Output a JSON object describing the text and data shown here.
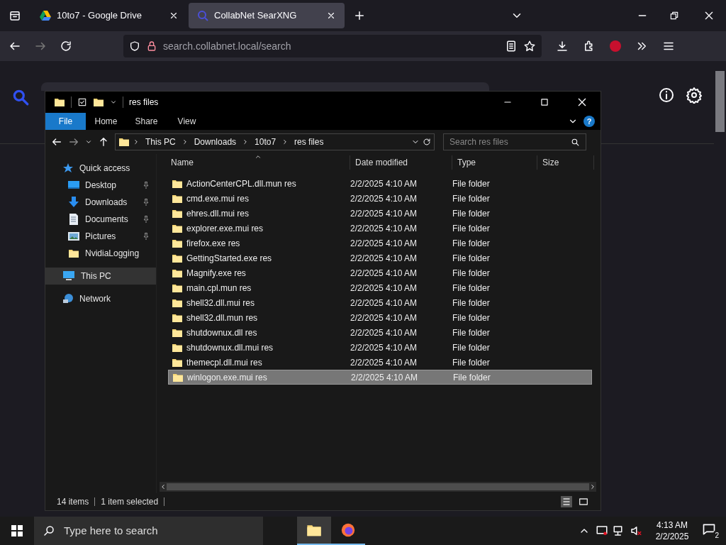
{
  "browser": {
    "tabs": [
      {
        "title": "10to7 - Google Drive",
        "kind": "drive",
        "selected": false
      },
      {
        "title": "CollabNet SearXNG",
        "kind": "searx",
        "selected": true
      }
    ],
    "url": {
      "host": "search.collabnet.local",
      "path": "/search"
    }
  },
  "explorer": {
    "title": "res files",
    "ribbon_tabs": [
      {
        "label": "File",
        "selected": true
      },
      {
        "label": "Home",
        "selected": false
      },
      {
        "label": "Share",
        "selected": false
      },
      {
        "label": "View",
        "selected": false
      }
    ],
    "breadcrumb": [
      "This PC",
      "Downloads",
      "10to7",
      "res files"
    ],
    "search": {
      "placeholder": "Search res files"
    },
    "nav": [
      {
        "label": "Quick access",
        "kind": "star",
        "selected": false,
        "children": [
          {
            "label": "Desktop",
            "kind": "desktop",
            "pinned": true,
            "selected": false
          },
          {
            "label": "Downloads",
            "kind": "download",
            "pinned": true,
            "selected": false
          },
          {
            "label": "Documents",
            "kind": "document",
            "pinned": true,
            "selected": false
          },
          {
            "label": "Pictures",
            "kind": "picture",
            "pinned": true,
            "selected": false
          },
          {
            "label": "NvidiaLogging",
            "kind": "folder",
            "pinned": false,
            "selected": false
          }
        ]
      },
      {
        "label": "This PC",
        "kind": "pc",
        "selected": true
      },
      {
        "label": "Network",
        "kind": "network",
        "selected": false
      }
    ],
    "help": "?",
    "columns": [
      "Name",
      "Date modified",
      "Type",
      "Size"
    ],
    "rows": [
      {
        "name": "ActionCenterCPL.dll.mun res",
        "date": "2/2/2025 4:10 AM",
        "type": "File folder",
        "selected": false
      },
      {
        "name": "cmd.exe.mui res",
        "date": "2/2/2025 4:10 AM",
        "type": "File folder",
        "selected": false
      },
      {
        "name": "ehres.dll.mui res",
        "date": "2/2/2025 4:10 AM",
        "type": "File folder",
        "selected": false
      },
      {
        "name": "explorer.exe.mui res",
        "date": "2/2/2025 4:10 AM",
        "type": "File folder",
        "selected": false
      },
      {
        "name": "firefox.exe res",
        "date": "2/2/2025 4:10 AM",
        "type": "File folder",
        "selected": false
      },
      {
        "name": "GettingStarted.exe res",
        "date": "2/2/2025 4:10 AM",
        "type": "File folder",
        "selected": false
      },
      {
        "name": "Magnify.exe res",
        "date": "2/2/2025 4:10 AM",
        "type": "File folder",
        "selected": false
      },
      {
        "name": "main.cpl.mun res",
        "date": "2/2/2025 4:10 AM",
        "type": "File folder",
        "selected": false
      },
      {
        "name": "shell32.dll.mui res",
        "date": "2/2/2025 4:10 AM",
        "type": "File folder",
        "selected": false
      },
      {
        "name": "shell32.dll.mun res",
        "date": "2/2/2025 4:10 AM",
        "type": "File folder",
        "selected": false
      },
      {
        "name": "shutdownux.dll res",
        "date": "2/2/2025 4:10 AM",
        "type": "File folder",
        "selected": false
      },
      {
        "name": "shutdownux.dll.mui res",
        "date": "2/2/2025 4:10 AM",
        "type": "File folder",
        "selected": false
      },
      {
        "name": "themecpl.dll.mui res",
        "date": "2/2/2025 4:10 AM",
        "type": "File folder",
        "selected": false
      },
      {
        "name": "winlogon.exe.mui res",
        "date": "2/2/2025 4:10 AM",
        "type": "File folder",
        "selected": true
      }
    ],
    "status": {
      "count": "14 items",
      "selection": "1 item selected"
    }
  },
  "taskbar": {
    "search_placeholder": "Type here to search",
    "time": "4:13 AM",
    "date": "2/2/2025",
    "notifications": "2"
  }
}
